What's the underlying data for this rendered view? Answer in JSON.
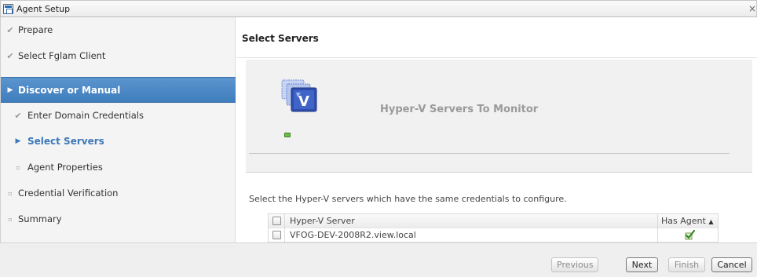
{
  "window": {
    "title": "Agent Setup",
    "close_glyph": "×",
    "icon": "agent-setup-icon"
  },
  "sidebar": {
    "steps": [
      {
        "label": "Prepare",
        "mark": "✔",
        "state": "done"
      },
      {
        "label": "Select Fglam Client",
        "mark": "✔",
        "state": "done"
      },
      {
        "label": "Discover or Manual",
        "mark": "▶",
        "state": "active"
      },
      {
        "label": "Enter Domain Credentials",
        "mark": "✔",
        "state": "done-sub"
      },
      {
        "label": "Select Servers",
        "mark": "▶",
        "state": "current-sub"
      },
      {
        "label": "Agent Properties",
        "mark": "▫",
        "state": "pending-sub"
      },
      {
        "label": "Credential Verification",
        "mark": "▫",
        "state": "pending"
      },
      {
        "label": "Summary",
        "mark": "▫",
        "state": "pending"
      }
    ]
  },
  "main": {
    "page_title": "Select Servers",
    "banner": {
      "title": "Hyper-V Servers To Monitor",
      "icon": "hyper-v-icon"
    },
    "instructions": "Select the Hyper-V servers which have the same credentials to configure.",
    "table": {
      "columns": {
        "server": "Hyper-V Server",
        "agent": "Has Agent",
        "sort": "▲"
      },
      "rows": [
        {
          "server": "VFOG-DEV-2008R2.view.local",
          "has_agent": true,
          "checked": false
        }
      ]
    }
  },
  "footer": {
    "previous": "Previous",
    "next": "Next",
    "finish": "Finish",
    "cancel": "Cancel"
  },
  "colors": {
    "active_step": "#4a88c7",
    "current_step_text": "#3d78b8",
    "banner_bg": "#f1f1f1"
  }
}
